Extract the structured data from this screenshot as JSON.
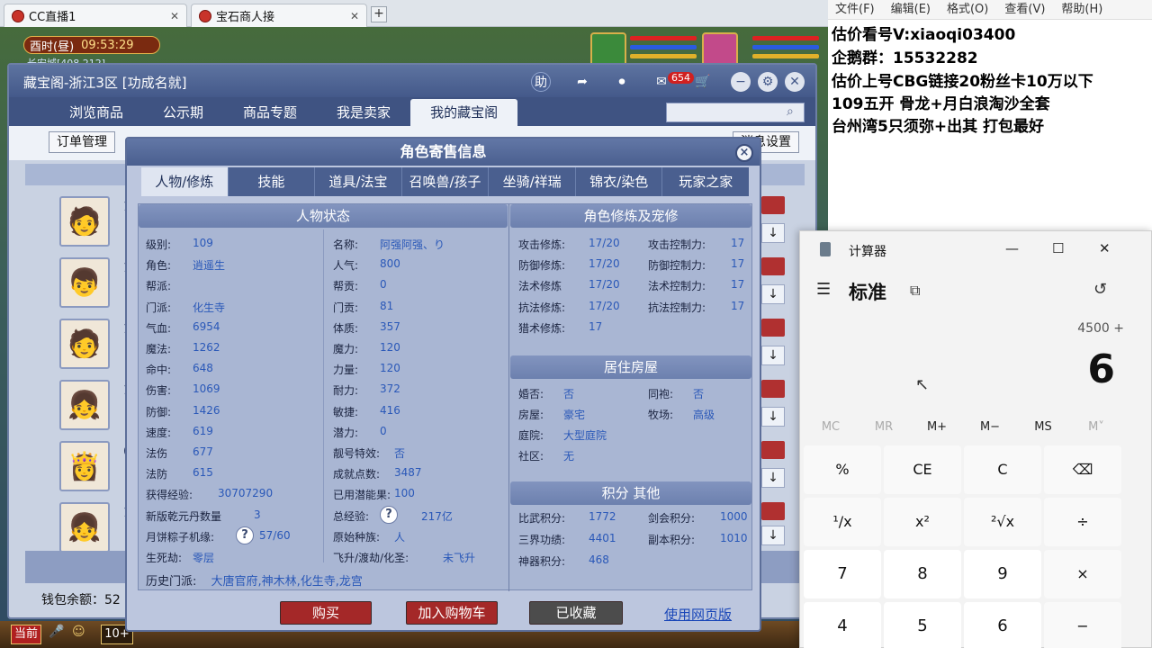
{
  "browser_tabs": [
    {
      "label": "CC直播1"
    },
    {
      "label": "宝石商人接"
    }
  ],
  "game": {
    "time_label": "酉时(昼)",
    "clock": "09:53:29",
    "location": "长安城[408,212]",
    "bottom_left": "当前",
    "bottom_count": "10+"
  },
  "cbg": {
    "title": "藏宝阁-浙江3区 [功成名就]",
    "header_help": "助",
    "badge_count": "654",
    "nav": [
      "浏览商品",
      "公示期",
      "商品专题",
      "我是卖家",
      "我的藏宝阁"
    ],
    "order_mgmt": "订单管理",
    "settings_btn": "消息设置",
    "wallet": "钱包余额：52",
    "row_leads": [
      "1",
      "1",
      "1",
      "1",
      "6",
      "1"
    ]
  },
  "dialog": {
    "title": "角色寄售信息",
    "close": "×",
    "tabs": [
      "人物/修炼",
      "技能",
      "道具/法宝",
      "召唤兽/孩子",
      "坐骑/祥瑞",
      "锦衣/染色",
      "玩家之家"
    ],
    "status": {
      "header": "人物状态",
      "left": [
        {
          "k": "级别:",
          "v": "109"
        },
        {
          "k": "角色:",
          "v": "逍遥生"
        },
        {
          "k": "帮派:",
          "v": ""
        },
        {
          "k": "门派:",
          "v": "化生寺"
        },
        {
          "k": "气血:",
          "v": "6954"
        },
        {
          "k": "魔法:",
          "v": "1262"
        },
        {
          "k": "命中:",
          "v": "648"
        },
        {
          "k": "伤害:",
          "v": "1069"
        },
        {
          "k": "防御:",
          "v": "1426"
        },
        {
          "k": "速度:",
          "v": "619"
        },
        {
          "k": "法伤",
          "v": "677"
        },
        {
          "k": "法防",
          "v": "615"
        },
        {
          "k": "获得经验:",
          "v": "30707290"
        },
        {
          "k": "新版乾元丹数量",
          "v": "3"
        },
        {
          "k": "月饼粽子机缘:",
          "v": "57/60"
        },
        {
          "k": "生死劫:",
          "v": "零层"
        }
      ],
      "right": [
        {
          "k": "名称:",
          "v": "阿强阿强、り"
        },
        {
          "k": "人气:",
          "v": "800"
        },
        {
          "k": "帮贡:",
          "v": "0"
        },
        {
          "k": "门贡:",
          "v": "81"
        },
        {
          "k": "体质:",
          "v": "357"
        },
        {
          "k": "魔力:",
          "v": "120"
        },
        {
          "k": "力量:",
          "v": "120"
        },
        {
          "k": "耐力:",
          "v": "372"
        },
        {
          "k": "敏捷:",
          "v": "416"
        },
        {
          "k": "潜力:",
          "v": "0"
        },
        {
          "k": "靓号特效:",
          "v": "否"
        },
        {
          "k": "成就点数:",
          "v": "3487"
        },
        {
          "k": "已用潜能果:",
          "v": "100"
        },
        {
          "k": "总经验:",
          "v": "217亿"
        },
        {
          "k": "原始种族:",
          "v": "人"
        },
        {
          "k": "飞升/渡劫/化圣:",
          "v": "未飞升"
        }
      ],
      "history_k": "历史门派:",
      "history_v": "大唐官府,神木林,化生寺,龙宫"
    },
    "cultivation": {
      "header": "角色修炼及宠修",
      "left": [
        {
          "k": "攻击修炼:",
          "v": "17/20"
        },
        {
          "k": "防御修炼:",
          "v": "17/20"
        },
        {
          "k": "法术修炼",
          "v": "17/20"
        },
        {
          "k": "抗法修炼:",
          "v": "17/20"
        },
        {
          "k": "猎术修炼:",
          "v": "17"
        }
      ],
      "right": [
        {
          "k": "攻击控制力:",
          "v": "17"
        },
        {
          "k": "防御控制力:",
          "v": "17"
        },
        {
          "k": "法术控制力:",
          "v": "17"
        },
        {
          "k": "抗法控制力:",
          "v": "17"
        }
      ]
    },
    "housing": {
      "header": "居住房屋",
      "rows": [
        {
          "k": "婚否:",
          "v": "否",
          "k2": "同袍:",
          "v2": "否"
        },
        {
          "k": "房屋:",
          "v": "豪宅",
          "k2": "牧场:",
          "v2": "高级"
        },
        {
          "k": "庭院:",
          "v": "大型庭院",
          "k2": "",
          "v2": ""
        },
        {
          "k": "社区:",
          "v": "无",
          "k2": "",
          "v2": ""
        }
      ]
    },
    "points": {
      "header": "积分 其他",
      "rows": [
        {
          "k": "比武积分:",
          "v": "1772",
          "k2": "剑会积分:",
          "v2": "1000"
        },
        {
          "k": "三界功绩:",
          "v": "4401",
          "k2": "副本积分:",
          "v2": "1010"
        },
        {
          "k": "神器积分:",
          "v": "468",
          "k2": "",
          "v2": ""
        }
      ]
    },
    "help_icon": "?",
    "actions": {
      "buy": "购买",
      "cart": "加入购物车",
      "saved": "已收藏",
      "web": "使用网页版"
    }
  },
  "notepad": {
    "menu": [
      "文件(F)",
      "编辑(E)",
      "格式(O)",
      "查看(V)",
      "帮助(H)"
    ],
    "lines": [
      "估价看号V:xiaoqi03400",
      "企鹅群：15532282",
      "估价上号CBG链接20粉丝卡10万以下",
      "109五开 骨龙+月白浪淘沙全套",
      "台州湾5只须弥+出其 打包最好"
    ]
  },
  "calculator": {
    "title": "计算器",
    "mode": "标准",
    "expression": "4500 +",
    "display": "6",
    "memory": [
      "MC",
      "MR",
      "M+",
      "M−",
      "MS",
      "M˅"
    ],
    "keys": [
      "%",
      "CE",
      "C",
      "⌫",
      "¹/x",
      "x²",
      "²√x",
      "÷",
      "7",
      "8",
      "9",
      "×",
      "4",
      "5",
      "6",
      "−"
    ]
  },
  "colors": {
    "accent_red": "#b03030",
    "link_blue": "#1a47b8",
    "value_blue": "#2a58b8"
  }
}
